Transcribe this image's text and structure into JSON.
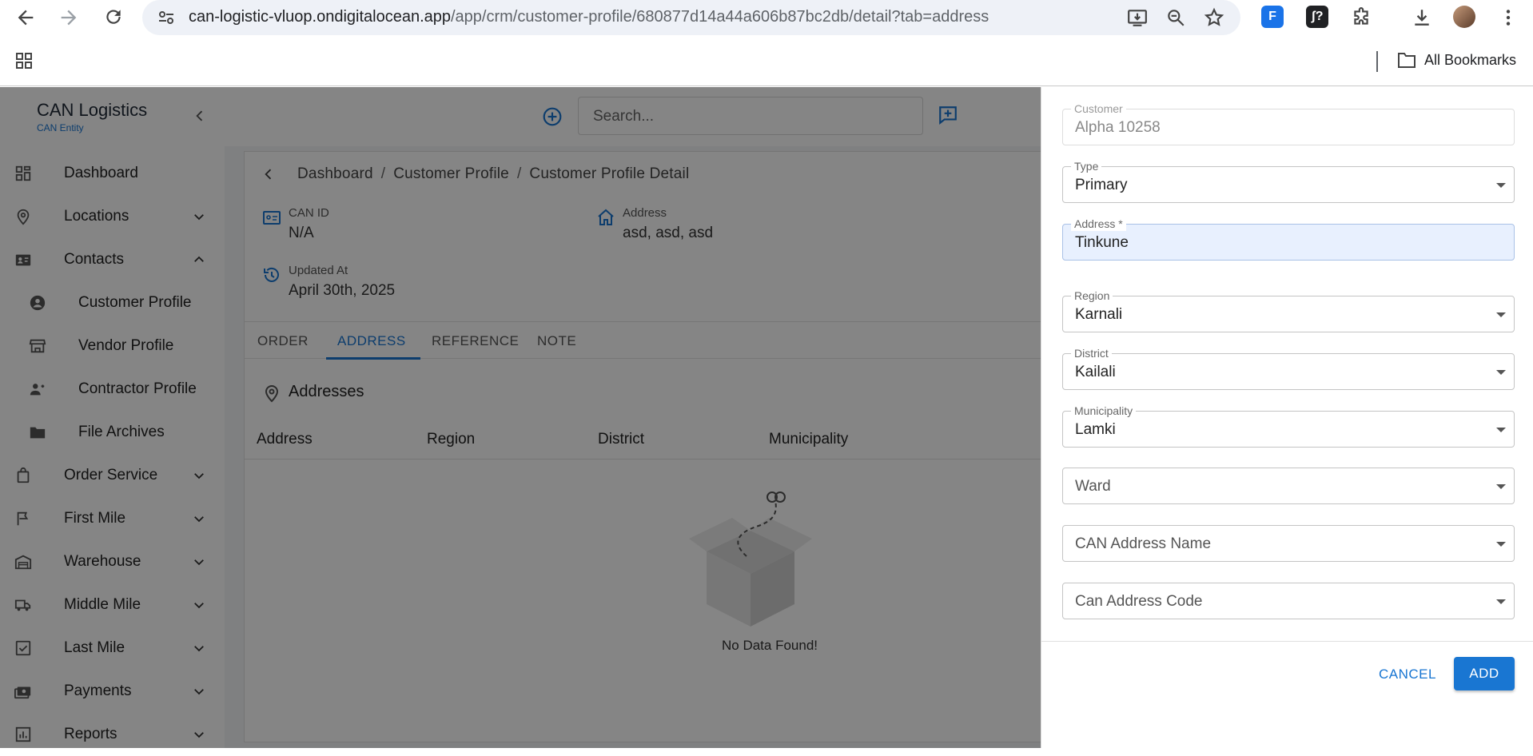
{
  "browser": {
    "url_host": "can-logistic-vluop.ondigitalocean.app",
    "url_path": "/app/crm/customer-profile/680877d14a44a606b87bc2db/detail?tab=address",
    "bookmarks_label": "All Bookmarks",
    "ext1_label": "F",
    "ext2_label": "ʃ?"
  },
  "sidebar": {
    "brand_title": "CAN Logistics",
    "brand_sub": "CAN Entity",
    "items": [
      {
        "label": "Dashboard",
        "icon": "dashboard-icon",
        "expand": "none"
      },
      {
        "label": "Locations",
        "icon": "location-icon",
        "expand": "down"
      },
      {
        "label": "Contacts",
        "icon": "contacts-icon",
        "expand": "up"
      },
      {
        "label": "Customer Profile",
        "icon": "person-icon",
        "expand": "none",
        "sub": true
      },
      {
        "label": "Vendor Profile",
        "icon": "store-icon",
        "expand": "none",
        "sub": true
      },
      {
        "label": "Contractor Profile",
        "icon": "worker-icon",
        "expand": "none",
        "sub": true
      },
      {
        "label": "File Archives",
        "icon": "folder-icon",
        "expand": "none",
        "sub": true
      },
      {
        "label": "Order Service",
        "icon": "bag-icon",
        "expand": "down"
      },
      {
        "label": "First Mile",
        "icon": "flag-icon",
        "expand": "down"
      },
      {
        "label": "Warehouse",
        "icon": "warehouse-icon",
        "expand": "down"
      },
      {
        "label": "Middle Mile",
        "icon": "truck-icon",
        "expand": "down"
      },
      {
        "label": "Last Mile",
        "icon": "check-square-icon",
        "expand": "down"
      },
      {
        "label": "Payments",
        "icon": "payments-icon",
        "expand": "down"
      },
      {
        "label": "Reports",
        "icon": "reports-icon",
        "expand": "down"
      }
    ]
  },
  "topbar": {
    "search_placeholder": "Search..."
  },
  "breadcrumb": [
    "Dashboard",
    "Customer Profile",
    "Customer Profile Detail"
  ],
  "info": {
    "can_id_label": "CAN ID",
    "can_id_value": "N/A",
    "address_label": "Address",
    "address_value": "asd, asd, asd",
    "updated_label": "Updated At",
    "updated_value": "April 30th, 2025"
  },
  "tabs": [
    "ORDER",
    "ADDRESS",
    "REFERENCE",
    "NOTE"
  ],
  "active_tab": "ADDRESS",
  "section_title": "Addresses",
  "table_headers": [
    "Address",
    "Region",
    "District",
    "Municipality"
  ],
  "empty_text": "No Data Found!",
  "form": {
    "customer_label": "Customer",
    "customer_value": "Alpha 10258",
    "type_label": "Type",
    "type_value": "Primary",
    "address_label": "Address *",
    "address_value": "Tinkune",
    "region_label": "Region",
    "region_value": "Karnali",
    "district_label": "District",
    "district_value": "Kailali",
    "municipality_label": "Municipality",
    "municipality_value": "Lamki",
    "ward_placeholder": "Ward",
    "can_address_name_placeholder": "CAN Address Name",
    "can_address_code_placeholder": "Can Address Code",
    "cancel_label": "CANCEL",
    "add_label": "ADD"
  },
  "colors": {
    "accent": "#1976d2",
    "overlay": "rgba(0,0,0,0.48)"
  }
}
